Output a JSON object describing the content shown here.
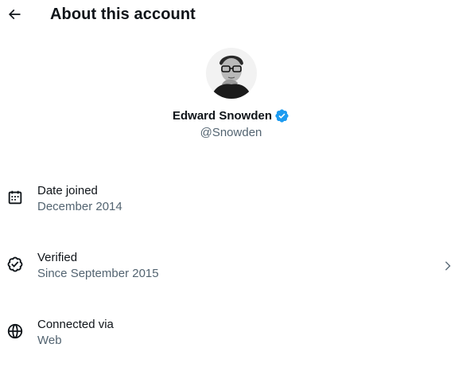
{
  "header": {
    "title": "About this account",
    "back_icon": "arrow-left-icon"
  },
  "profile": {
    "display_name": "Edward Snowden",
    "handle": "@Snowden",
    "verified": true,
    "badge_color": "#1d9bf0"
  },
  "details": [
    {
      "label": "Date joined",
      "value": "December 2014",
      "icon": "calendar-icon"
    },
    {
      "label": "Verified",
      "value": "Since September 2015",
      "icon": "verified-check-icon",
      "has_chevron": true
    },
    {
      "label": "Connected via",
      "value": "Web",
      "icon": "globe-icon"
    }
  ],
  "colors": {
    "primary_text": "#0f1419",
    "secondary_text": "#536471",
    "accent": "#1d9bf0"
  }
}
